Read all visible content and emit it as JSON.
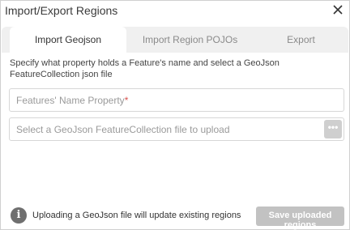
{
  "dialog": {
    "title": "Import/Export Regions"
  },
  "tabs": [
    {
      "label": "Import Geojson",
      "active": true
    },
    {
      "label": "Import Region POJOs",
      "active": false
    },
    {
      "label": "Export",
      "active": false
    }
  ],
  "import_geojson": {
    "description": "Specify what property holds a Feature's name and select a GeoJson FeatureCollection json file",
    "name_property": {
      "label": "Features' Name Property",
      "required_marker": "*",
      "value": ""
    },
    "file_input": {
      "placeholder": "Select a GeoJson FeatureCollection file to upload",
      "browse_label": "•••"
    }
  },
  "footer": {
    "info_icon": "info-icon",
    "info_text": "Uploading a GeoJson file will update existing regions",
    "save_label": "Save uploaded regions",
    "save_enabled": false
  },
  "colors": {
    "tab_bar": "#f0f0f0",
    "disabled_button": "#c2c2c2",
    "required": "#d9534f"
  }
}
